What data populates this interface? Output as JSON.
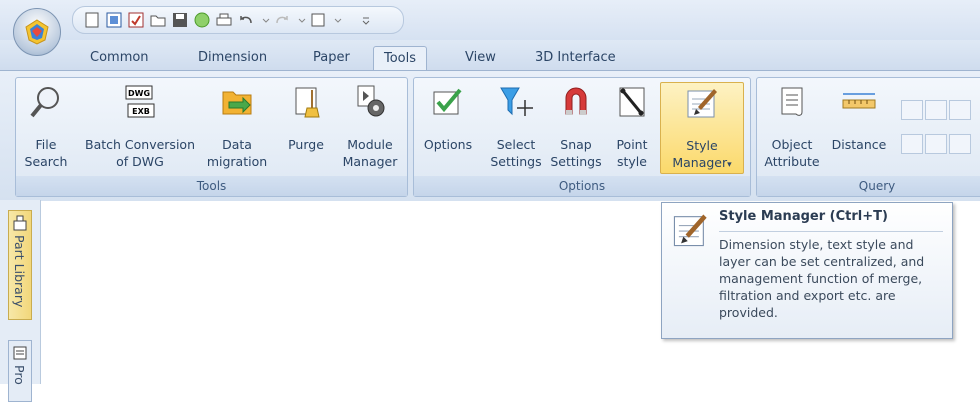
{
  "tabs": [
    "Common",
    "Dimension",
    "Paper",
    "Tools",
    "View",
    "3D Interface"
  ],
  "groups": {
    "tools": {
      "label": "Tools",
      "buttons": [
        {
          "line1": "File",
          "line2": "Search",
          "icon": "magnifier-icon"
        },
        {
          "line1": "Batch Conversion",
          "line2": "of DWG",
          "icon": "dwg-exb-icon"
        },
        {
          "line1": "Data",
          "line2": "migration",
          "icon": "data-migration-icon"
        },
        {
          "line1": "Purge",
          "line2": "",
          "icon": "broom-icon"
        },
        {
          "line1": "Module",
          "line2": "Manager",
          "icon": "gear-icon"
        }
      ],
      "dwg_badge": "DWG",
      "exb_badge": "EXB"
    },
    "options": {
      "label": "Options",
      "buttons": [
        {
          "line1": "Options",
          "line2": "",
          "icon": "checkmark-icon"
        },
        {
          "line1": "Select",
          "line2": "Settings",
          "icon": "filter-icon"
        },
        {
          "line1": "Snap",
          "line2": "Settings",
          "icon": "magnet-icon"
        },
        {
          "line1": "Point",
          "line2": "style",
          "icon": "point-icon"
        },
        {
          "line1": "Style",
          "line2": "Manager",
          "icon": "style-manager-icon"
        }
      ]
    },
    "query": {
      "label": "Query",
      "buttons": [
        {
          "line1": "Object",
          "line2": "Attribute",
          "icon": "scroll-icon"
        },
        {
          "line1": "Distance",
          "line2": "",
          "icon": "ruler-icon"
        }
      ]
    }
  },
  "sidebar": {
    "tab1": "Part Library",
    "tab2": "Pro"
  },
  "tooltip": {
    "title": "Style Manager (Ctrl+T)",
    "body": "Dimension style, text style and layer can be set centralized, and management function of merge, filtration and export etc. are provided."
  },
  "colors": {
    "accent": "#fbd96b",
    "ribbon": "#dde7f3"
  }
}
